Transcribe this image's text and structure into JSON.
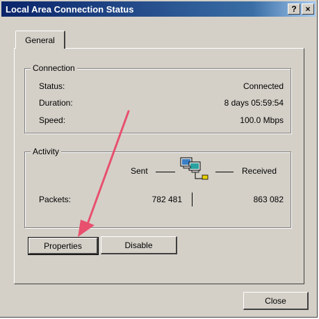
{
  "window": {
    "title": "Local Area Connection Status",
    "help_icon": "?",
    "close_icon": "×"
  },
  "tabs": [
    {
      "label": "General"
    }
  ],
  "connection": {
    "legend": "Connection",
    "rows": [
      {
        "label": "Status:",
        "value": "Connected"
      },
      {
        "label": "Duration:",
        "value": "8 days 05:59:54"
      },
      {
        "label": "Speed:",
        "value": "100.0 Mbps"
      }
    ]
  },
  "activity": {
    "legend": "Activity",
    "sent_label": "Sent",
    "received_label": "Received",
    "packets_label": "Packets:",
    "packets_sent": "782 481",
    "packets_received": "863 082",
    "icon": "network-computers-icon"
  },
  "buttons": {
    "properties": "Properties",
    "disable": "Disable",
    "close": "Close"
  },
  "annotation": {
    "arrow_color": "#e8506e"
  },
  "colors": {
    "title_start": "#0a246a",
    "title_end": "#a6caf0",
    "face": "#d4d0c8"
  }
}
